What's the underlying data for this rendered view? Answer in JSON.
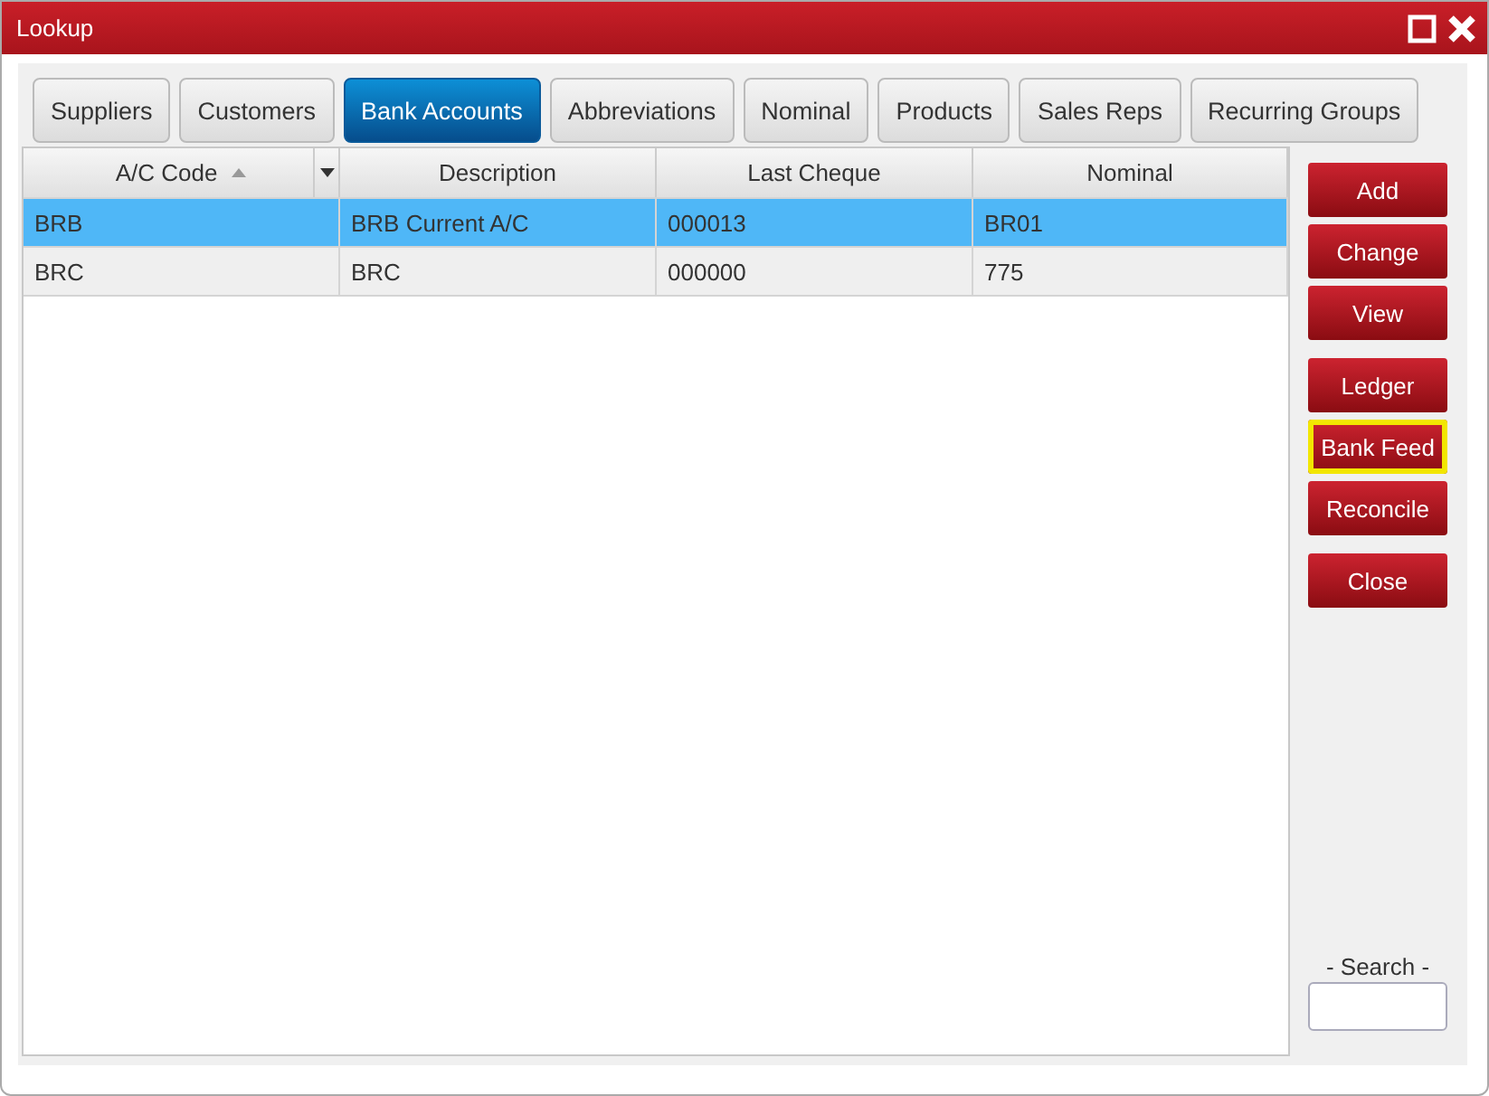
{
  "window": {
    "title": "Lookup"
  },
  "tabs": [
    {
      "label": "Suppliers",
      "selected": false
    },
    {
      "label": "Customers",
      "selected": false
    },
    {
      "label": "Bank Accounts",
      "selected": true
    },
    {
      "label": "Abbreviations",
      "selected": false
    },
    {
      "label": "Nominal",
      "selected": false
    },
    {
      "label": "Products",
      "selected": false
    },
    {
      "label": "Sales Reps",
      "selected": false
    },
    {
      "label": "Recurring Groups",
      "selected": false
    }
  ],
  "table": {
    "columns": [
      {
        "label": "A/C Code",
        "sort_ascending": true
      },
      {
        "label": "Description"
      },
      {
        "label": "Last Cheque"
      },
      {
        "label": "Nominal"
      }
    ],
    "rows": [
      {
        "cells": [
          "BRB",
          "BRB Current A/C",
          "000013",
          "BR01"
        ],
        "selected": true
      },
      {
        "cells": [
          "BRC",
          "BRC",
          "000000",
          "775"
        ],
        "selected": false
      }
    ]
  },
  "button_groups": [
    [
      {
        "label": "Add",
        "focused": false
      },
      {
        "label": "Change",
        "focused": false
      },
      {
        "label": "View",
        "focused": false
      }
    ],
    [
      {
        "label": "Ledger",
        "focused": false
      },
      {
        "label": "Bank Feed",
        "focused": true
      },
      {
        "label": "Reconcile",
        "focused": false
      }
    ],
    [
      {
        "label": "Close",
        "focused": false
      }
    ]
  ],
  "search": {
    "label": "- Search -"
  }
}
